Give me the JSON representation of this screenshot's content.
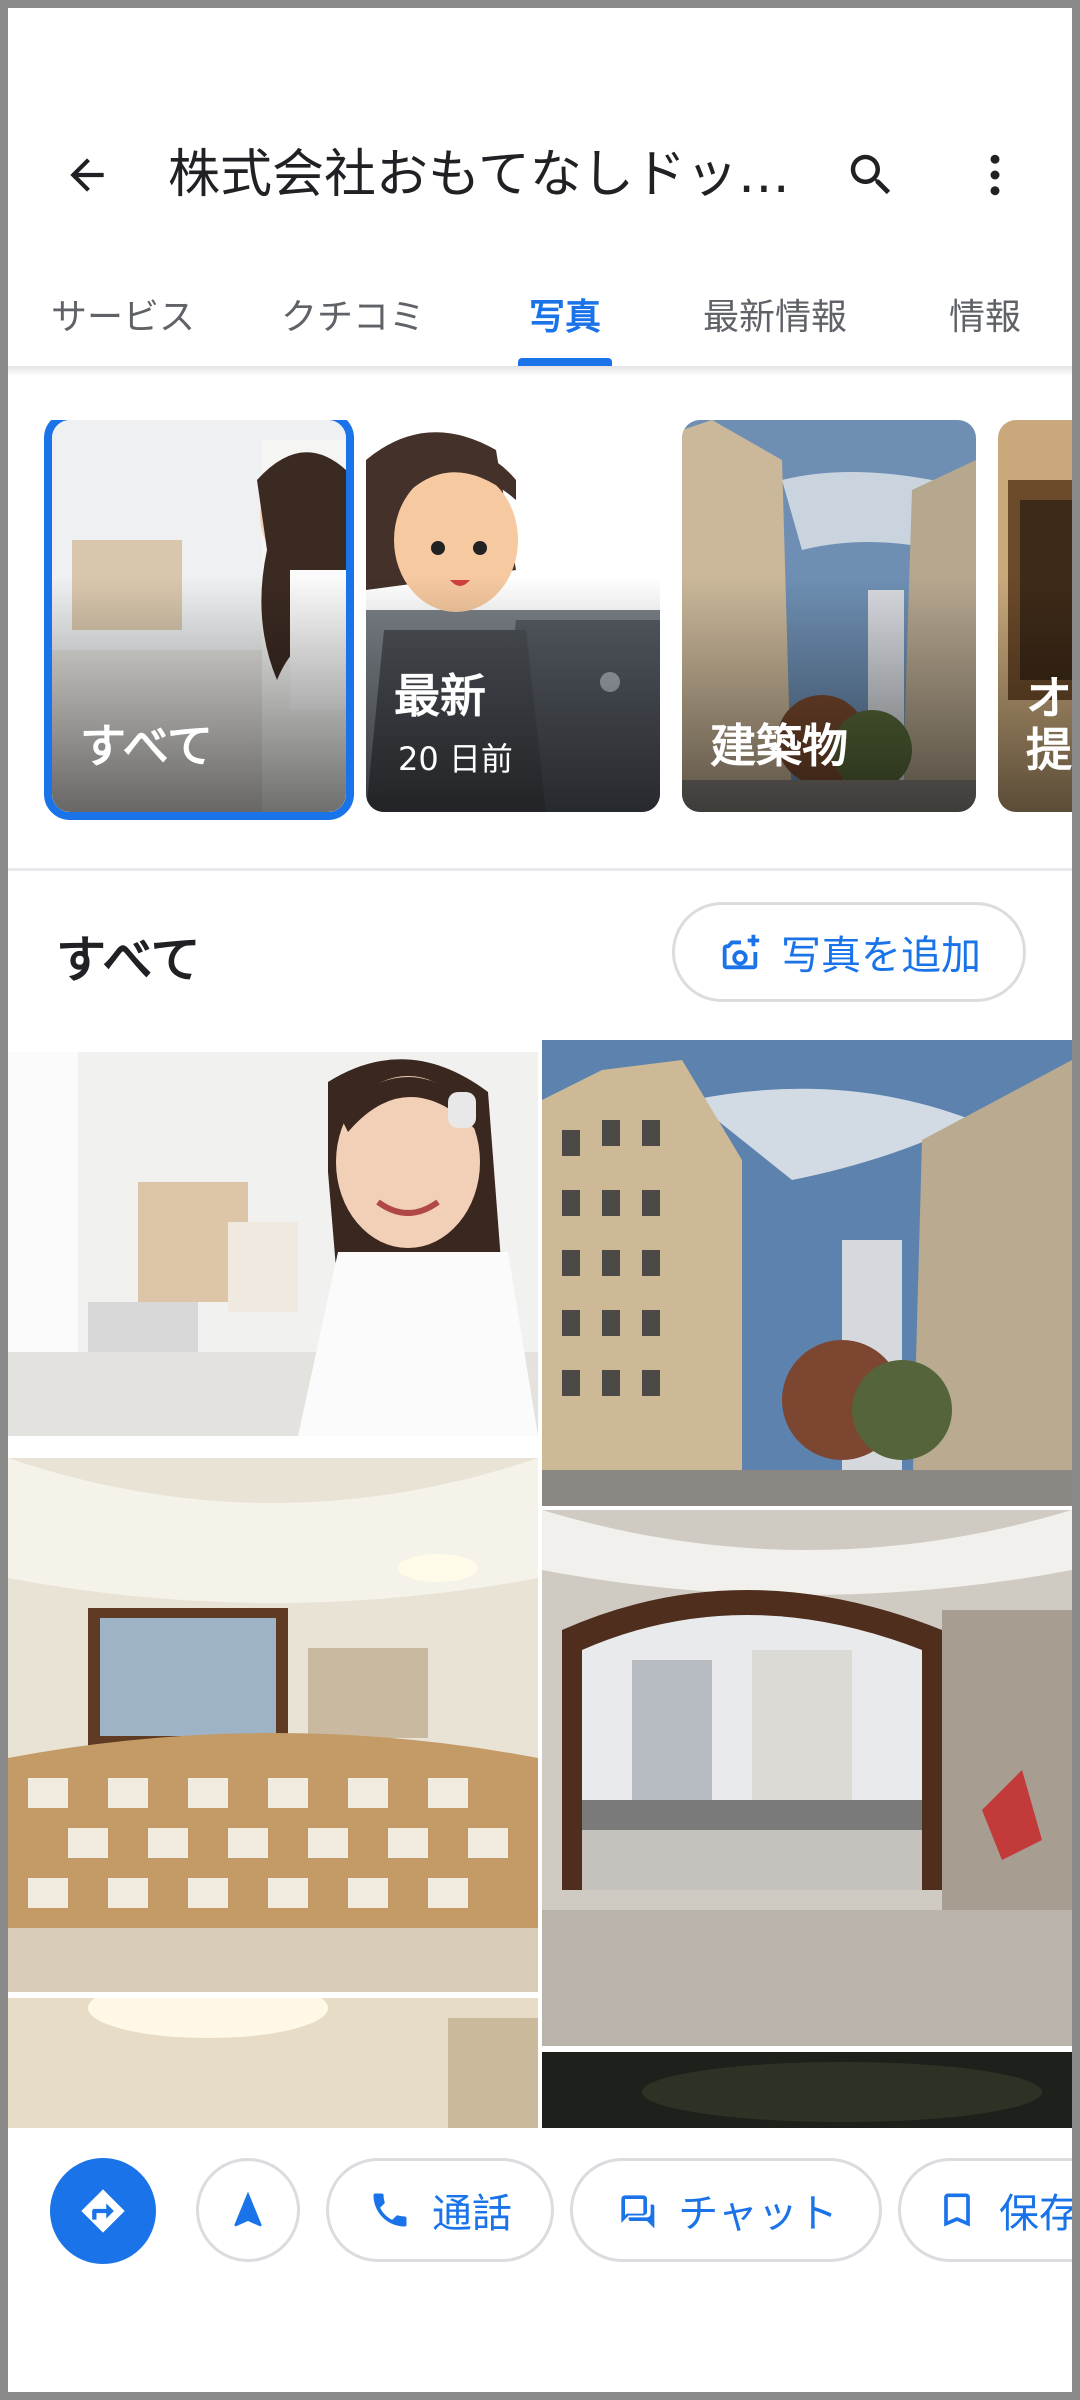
{
  "header": {
    "title": "株式会社おもてなしドッ…",
    "back_icon": "arrow-back-icon",
    "search_icon": "search-icon",
    "more_icon": "more-vert-icon"
  },
  "tabs": [
    {
      "label": "サービス",
      "active": false
    },
    {
      "label": "クチコミ",
      "active": false
    },
    {
      "label": "写真",
      "active": true
    },
    {
      "label": "最新情報",
      "active": false
    },
    {
      "label": "情報",
      "active": false
    }
  ],
  "categories": [
    {
      "label": "すべて",
      "sub": "",
      "selected": true
    },
    {
      "label": "最新",
      "sub": "20 日前",
      "selected": false
    },
    {
      "label": "建築物",
      "sub": "",
      "selected": false
    },
    {
      "label": "オ提",
      "sub": "",
      "selected": false
    }
  ],
  "section": {
    "title": "すべて",
    "add_photo_label": "写真を追加",
    "add_photo_icon": "add-photo-icon"
  },
  "actions": {
    "directions_icon": "directions-icon",
    "start_icon": "navigation-arrow-icon",
    "call_label": "通話",
    "call_icon": "phone-icon",
    "chat_label": "チャット",
    "chat_icon": "chat-icon",
    "save_label": "保存",
    "save_icon": "bookmark-icon"
  },
  "colors": {
    "accent": "#1a73e8",
    "text": "#202124",
    "muted": "#5f6368",
    "border": "#dadce0"
  }
}
